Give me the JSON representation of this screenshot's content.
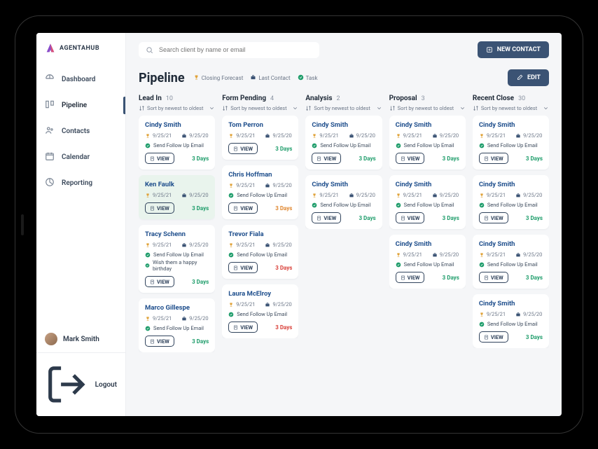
{
  "brand": {
    "name": "AGENTAHUB"
  },
  "nav": {
    "items": [
      {
        "label": "Dashboard",
        "icon": "dashboard"
      },
      {
        "label": "Pipeline",
        "icon": "pipeline",
        "active": true
      },
      {
        "label": "Contacts",
        "icon": "contacts"
      },
      {
        "label": "Calendar",
        "icon": "calendar"
      },
      {
        "label": "Reporting",
        "icon": "reporting"
      }
    ]
  },
  "user": {
    "name": "Mark Smith"
  },
  "logout_label": "Logout",
  "search": {
    "placeholder": "Search client by name or email"
  },
  "buttons": {
    "new_contact": "NEW CONTACT",
    "edit": "EDIT",
    "view": "VIEW"
  },
  "page": {
    "title": "Pipeline"
  },
  "legend": [
    {
      "label": "Closing Forecast",
      "icon": "trophy"
    },
    {
      "label": "Last Contact",
      "icon": "briefcase"
    },
    {
      "label": "Task",
      "icon": "check"
    }
  ],
  "sort_label": "Sort by newest to oldest",
  "columns": [
    {
      "title": "Lead In",
      "count": "10",
      "cards": [
        {
          "name": "Cindy Smith",
          "closing": "9/25/21",
          "last": "9/25/20",
          "tasks": [
            "Send Follow Up Email"
          ],
          "days": "3 Days",
          "color": "g"
        },
        {
          "name": "Ken Faulk",
          "closing": "9/25/21",
          "last": "9/25/20",
          "tasks": [],
          "days": "3 Days",
          "color": "g",
          "hl": true
        },
        {
          "name": "Tracy Schenn",
          "closing": "9/25/21",
          "last": "9/25/20",
          "tasks": [
            "Send Follow Up Email",
            "Wish them a happy birthday"
          ],
          "days": "3 Days",
          "color": "g"
        },
        {
          "name": "Marco Gillespe",
          "closing": "9/25/21",
          "last": "9/25/20",
          "tasks": [
            "Send Follow Up Email"
          ],
          "days": "3 Days",
          "color": "g"
        }
      ]
    },
    {
      "title": "Form Pending",
      "count": "4",
      "cards": [
        {
          "name": "Tom Perron",
          "closing": "9/25/21",
          "last": "9/25/20",
          "tasks": [],
          "days": "3 Days",
          "color": "g"
        },
        {
          "name": "Chris Hoffman",
          "closing": "9/25/21",
          "last": "9/25/20",
          "tasks": [
            "Send Follow Up Email"
          ],
          "days": "3 Days",
          "color": "o"
        },
        {
          "name": "Trevor Fiala",
          "closing": "9/25/21",
          "last": "9/25/20",
          "tasks": [
            "Send Follow Up Email"
          ],
          "days": "3 Days",
          "color": "r"
        },
        {
          "name": "Laura McElroy",
          "closing": "9/25/21",
          "last": "9/25/20",
          "tasks": [
            "Send Follow Up Email"
          ],
          "days": "3 Days",
          "color": "r"
        }
      ]
    },
    {
      "title": "Analysis",
      "count": "2",
      "cards": [
        {
          "name": "Cindy Smith",
          "closing": "9/25/21",
          "last": "9/25/20",
          "tasks": [
            "Send Follow Up Email"
          ],
          "days": "3 Days",
          "color": "g"
        },
        {
          "name": "Cindy Smith",
          "closing": "9/25/21",
          "last": "9/25/20",
          "tasks": [
            "Send Follow Up Email"
          ],
          "days": "3 Days",
          "color": "g"
        }
      ]
    },
    {
      "title": "Proposal",
      "count": "3",
      "cards": [
        {
          "name": "Cindy Smith",
          "closing": "9/25/21",
          "last": "9/25/20",
          "tasks": [
            "Send Follow Up Email"
          ],
          "days": "3 Days",
          "color": "g"
        },
        {
          "name": "Cindy Smith",
          "closing": "9/25/21",
          "last": "9/25/20",
          "tasks": [
            "Send Follow Up Email"
          ],
          "days": "3 Days",
          "color": "g"
        },
        {
          "name": "Cindy Smith",
          "closing": "9/25/21",
          "last": "9/25/20",
          "tasks": [
            "Send Follow Up Email"
          ],
          "days": "3 Days",
          "color": "g"
        }
      ]
    },
    {
      "title": "Recent Close",
      "count": "30",
      "cards": [
        {
          "name": "Cindy Smith",
          "closing": "9/25/21",
          "last": "9/25/20",
          "tasks": [
            "Send Follow Up Email"
          ],
          "days": "3 Days",
          "color": "g"
        },
        {
          "name": "Cindy Smith",
          "closing": "9/25/21",
          "last": "9/25/20",
          "tasks": [
            "Send Follow Up Email"
          ],
          "days": "3 Days",
          "color": "g"
        },
        {
          "name": "Cindy Smith",
          "closing": "9/25/21",
          "last": "9/25/20",
          "tasks": [
            "Send Follow Up Email"
          ],
          "days": "3 Days",
          "color": "g"
        },
        {
          "name": "Cindy Smith",
          "closing": "9/25/21",
          "last": "9/25/20",
          "tasks": [
            "Send Follow Up Email"
          ],
          "days": "3 Days",
          "color": "g"
        }
      ]
    }
  ]
}
